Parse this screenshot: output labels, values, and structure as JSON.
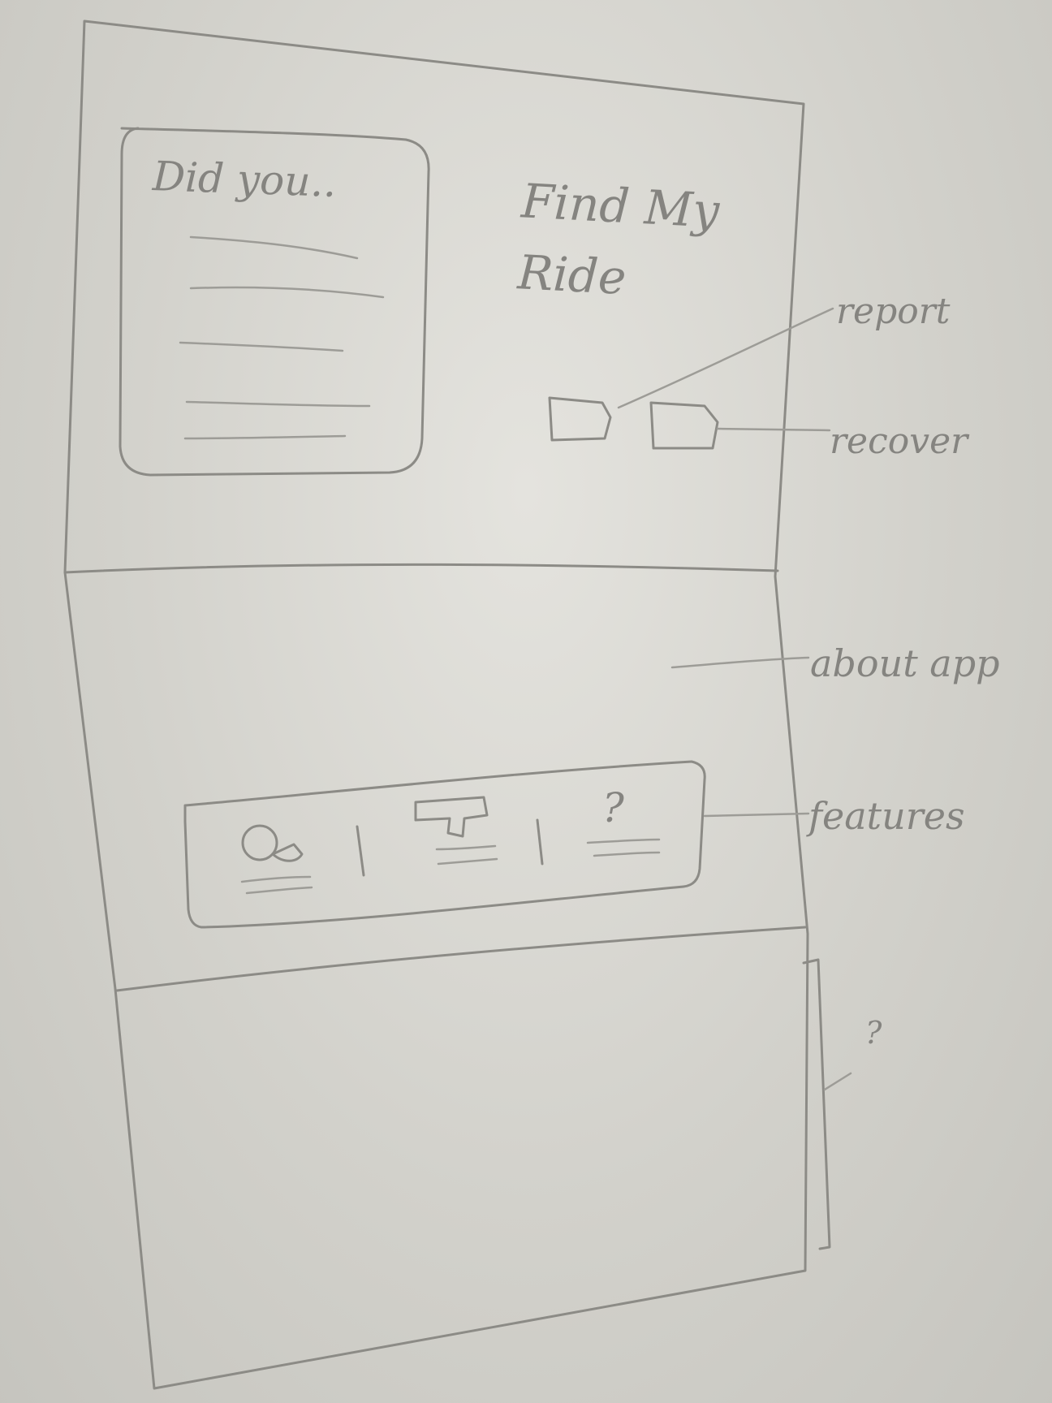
{
  "sketch": {
    "preview_card": {
      "title": "Did you.."
    },
    "header": {
      "app_title": "Find My Ride"
    },
    "annotations": {
      "report": "report",
      "recover": "recover",
      "about_app": "about app",
      "features": "features",
      "unknown_section": "?"
    },
    "feature_bar": {
      "items": [
        {
          "icon": "magnifier-icon"
        },
        {
          "icon": "camera-icon"
        },
        {
          "icon": "help-icon",
          "glyph": "?"
        }
      ]
    }
  }
}
